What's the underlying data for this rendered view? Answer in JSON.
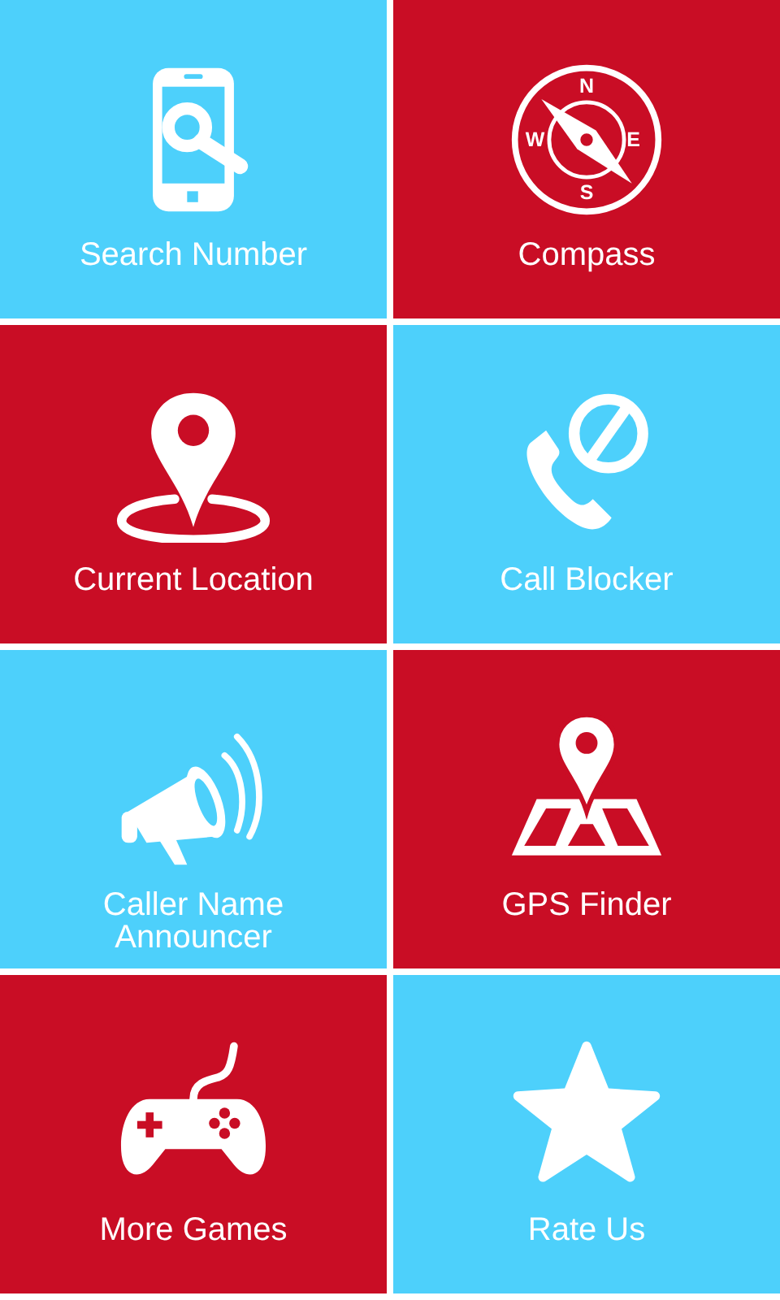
{
  "compass_dial": {
    "points": [
      "N",
      "E",
      "S",
      "W"
    ]
  },
  "tiles": [
    {
      "kind": "phone-search",
      "label": "Search Number",
      "color": "#4dd0fb"
    },
    {
      "kind": "compass",
      "label": "Compass",
      "color": "#c90d25"
    },
    {
      "kind": "location",
      "label": "Current Location",
      "color": "#c90d25"
    },
    {
      "kind": "call-block",
      "label": "Call Blocker",
      "color": "#4dd0fb"
    },
    {
      "kind": "megaphone",
      "label": "Caller Name\nAnnouncer",
      "color": "#4dd0fb"
    },
    {
      "kind": "map",
      "label": "GPS Finder",
      "color": "#c90d25"
    },
    {
      "kind": "gamepad",
      "label": "More Games",
      "color": "#c90d25"
    },
    {
      "kind": "star",
      "label": "Rate Us",
      "color": "#4dd0fb"
    }
  ]
}
